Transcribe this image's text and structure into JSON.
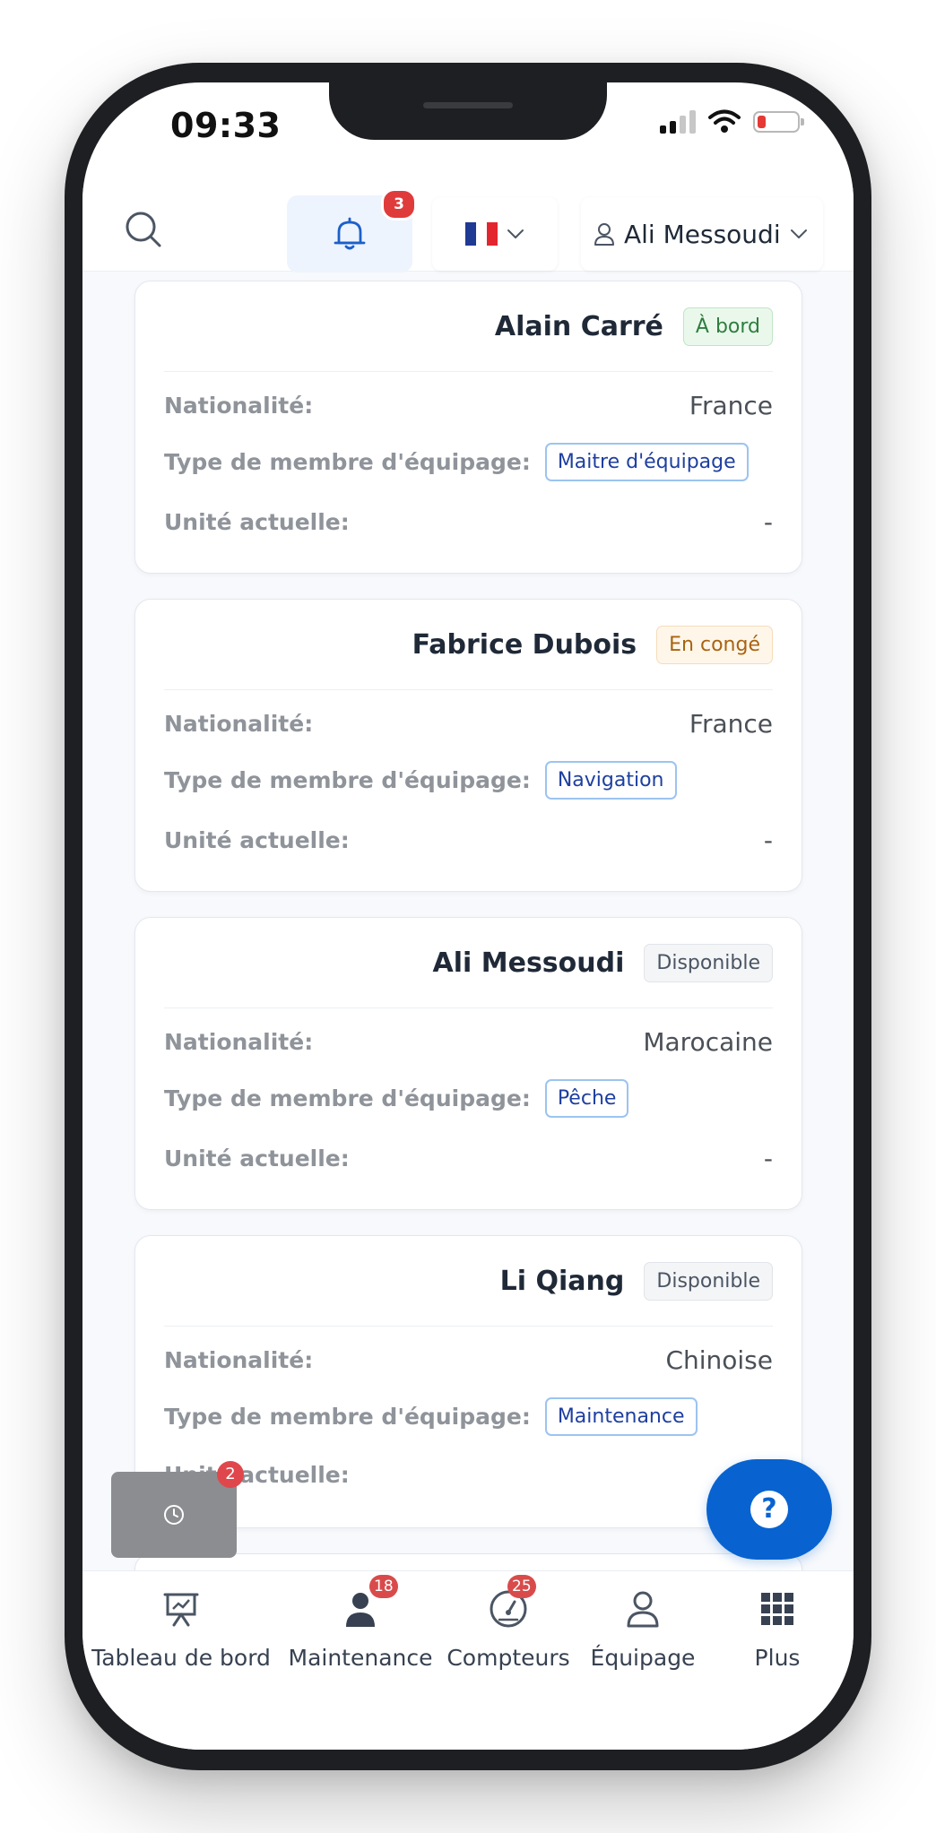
{
  "status_bar": {
    "time": "09:33"
  },
  "header": {
    "notification_count": "3",
    "user_name": "Ali Messoudi"
  },
  "labels": {
    "nationality": "Nationalité:",
    "crew_type": "Type de membre d'équipage:",
    "current_unit": "Unité actuelle:"
  },
  "crew": [
    {
      "name": "Alain Carré",
      "status": "À bord",
      "status_color": "green",
      "nationality": "France",
      "type": "Maitre d'équipage",
      "unit": "-"
    },
    {
      "name": "Fabrice Dubois",
      "status": "En congé",
      "status_color": "orange",
      "nationality": "France",
      "type": "Navigation",
      "unit": "-"
    },
    {
      "name": "Ali Messoudi",
      "status": "Disponible",
      "status_color": "gray",
      "nationality": "Marocaine",
      "type": "Pêche",
      "unit": "-"
    },
    {
      "name": "Li Qiang",
      "status": "Disponible",
      "status_color": "gray",
      "nationality": "Chinoise",
      "type": "Maintenance",
      "unit": ""
    }
  ],
  "floating": {
    "history_badge": "2",
    "help_symbol": "?"
  },
  "bottom_nav": [
    {
      "label": "Tableau de bord",
      "icon": "presentation-board-icon",
      "badge": ""
    },
    {
      "label": "Maintenance",
      "icon": "person-icon",
      "badge": "18"
    },
    {
      "label": "Compteurs",
      "icon": "gauge-icon",
      "badge": "25"
    },
    {
      "label": "Équipage",
      "icon": "user-outline-icon",
      "badge": ""
    },
    {
      "label": "Plus",
      "icon": "grid-icon",
      "badge": ""
    }
  ],
  "colors": {
    "accent": "#0863d0",
    "badge_red": "#e03b3b",
    "flag_blue": "#1f3a93",
    "flag_red": "#e3262e"
  }
}
